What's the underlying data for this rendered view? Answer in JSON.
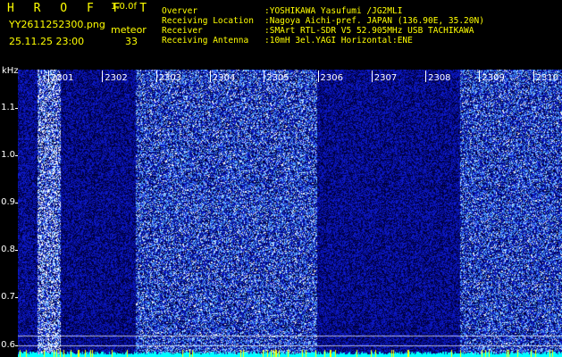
{
  "header": {
    "app_title": "H R O F F T",
    "version": "1.0.0f",
    "file_name": "YY2611252300.png",
    "meteor_label": "meteor",
    "timestamp": "25.11.25 23:00",
    "meteor_count": "33"
  },
  "info": {
    "observer_key": "Overver",
    "observer_value": ":YOSHIKAWA Yasufumi /JG2MLI",
    "location_key": "Receiving Location",
    "location_value": ":Nagoya Aichi-pref. JAPAN (136.90E, 35.20N)",
    "receiver_key": "Receiver",
    "receiver_value": ":SMArt RTL-SDR V5 52.905MHz USB TACHIKAWA",
    "antenna_key": "Receiving Antenna",
    "antenna_value": ":10mH 3el.YAGI Horizontal:ENE"
  },
  "chart_data": {
    "type": "heatmap",
    "ylabel": "kHz",
    "y_ticks": [
      "1.1",
      "1.0",
      "0.9",
      "0.8",
      "0.7",
      "0.6"
    ],
    "y_range": [
      0.575,
      1.18
    ],
    "x_ticks": [
      "2301",
      "2302",
      "2303",
      "2304",
      "2305",
      "2306",
      "2307",
      "2308",
      "2309",
      "2310"
    ],
    "x_unit": "minutes (HHMM)",
    "reference_lines_khz": [
      0.62,
      0.6
    ],
    "bright_bands": [
      "2300-2301",
      "2302-2305",
      "2308-2310"
    ],
    "colors": {
      "background": "#000000",
      "text": "#ffff00",
      "low": "#000060",
      "high": "#ffffff",
      "baseline": "#00ffff"
    }
  }
}
